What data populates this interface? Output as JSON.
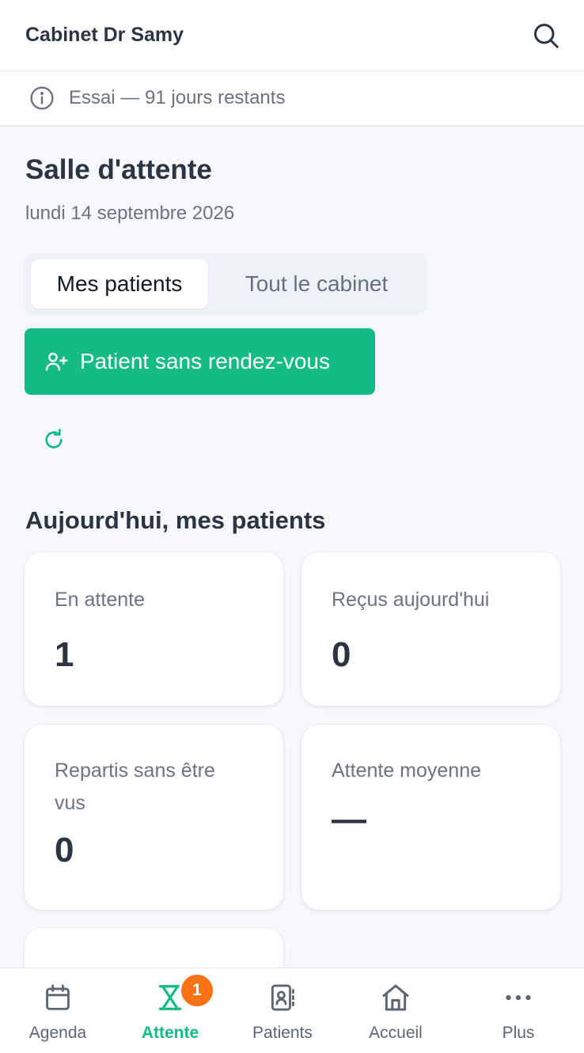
{
  "header": {
    "title": "Cabinet Dr Samy",
    "search_icon": "search-icon"
  },
  "trial": {
    "text": "Essai — 91 jours restants",
    "icon": "info-icon"
  },
  "page": {
    "title": "Salle d'attente",
    "date": "lundi 14 septembre 2026"
  },
  "tabs": [
    {
      "label": "Mes patients",
      "active": true
    },
    {
      "label": "Tout le cabinet",
      "active": false
    }
  ],
  "walkin_button": {
    "label": "Patient sans rendez-vous",
    "icon": "user-plus-icon"
  },
  "refresh": {
    "icon": "refresh-icon"
  },
  "section": {
    "title": "Aujourd'hui, mes patients"
  },
  "stats": [
    {
      "label": "En attente",
      "value": "1"
    },
    {
      "label": "Reçus aujourd'hui",
      "value": "0"
    },
    {
      "label": "Repartis sans être vus",
      "value": "0"
    },
    {
      "label": "Attente moyenne",
      "value": "—"
    }
  ],
  "nav": [
    {
      "label": "Agenda",
      "icon": "calendar-icon",
      "active": false
    },
    {
      "label": "Attente",
      "icon": "hourglass-icon",
      "active": true,
      "badge": "1"
    },
    {
      "label": "Patients",
      "icon": "contacts-icon",
      "active": false
    },
    {
      "label": "Accueil",
      "icon": "home-icon",
      "active": false
    },
    {
      "label": "Plus",
      "icon": "more-icon",
      "active": false
    }
  ],
  "colors": {
    "accent": "#14bb85",
    "badge": "#f97316",
    "text": "#2b3443",
    "muted": "#6b7280",
    "background": "#f6f8fb"
  }
}
